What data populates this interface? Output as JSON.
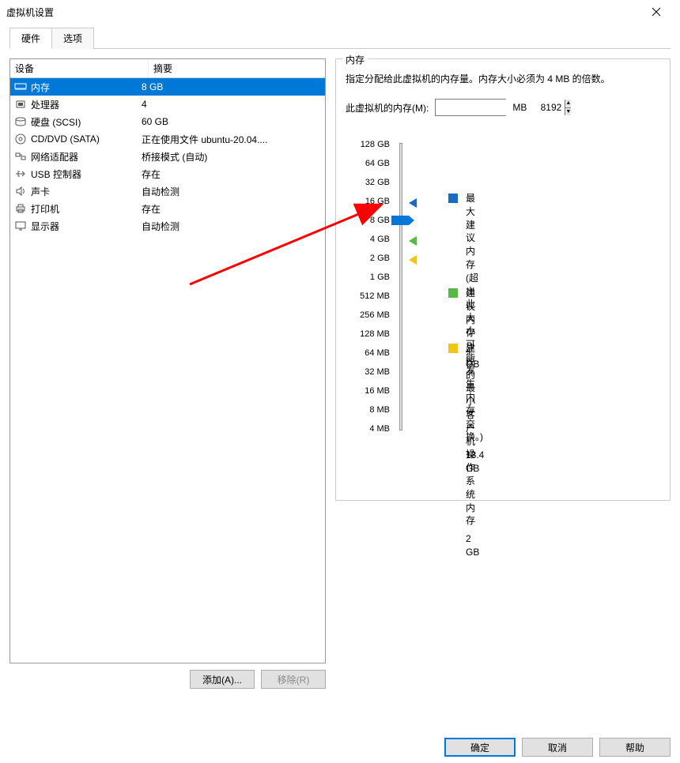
{
  "window": {
    "title": "虚拟机设置"
  },
  "tabs": {
    "hardware": "硬件",
    "options": "选项"
  },
  "table": {
    "col_device": "设备",
    "col_summary": "摘要",
    "rows": [
      {
        "name": "内存",
        "summary": "8 GB",
        "icon": "memory"
      },
      {
        "name": "处理器",
        "summary": "4",
        "icon": "cpu"
      },
      {
        "name": "硬盘 (SCSI)",
        "summary": "60 GB",
        "icon": "disk"
      },
      {
        "name": "CD/DVD (SATA)",
        "summary": "正在使用文件 ubuntu-20.04....",
        "icon": "cd"
      },
      {
        "name": "网络适配器",
        "summary": "桥接模式 (自动)",
        "icon": "net"
      },
      {
        "name": "USB 控制器",
        "summary": "存在",
        "icon": "usb"
      },
      {
        "name": "声卡",
        "summary": "自动检测",
        "icon": "audio"
      },
      {
        "name": "打印机",
        "summary": "存在",
        "icon": "printer"
      },
      {
        "name": "显示器",
        "summary": "自动检测",
        "icon": "display"
      }
    ]
  },
  "buttons": {
    "add": "添加(A)...",
    "remove": "移除(R)",
    "ok": "确定",
    "cancel": "取消",
    "help": "帮助"
  },
  "memory": {
    "panel_title": "内存",
    "description": "指定分配给此虚拟机的内存量。内存大小必须为 4 MB 的倍数。",
    "field_label": "此虚拟机的内存(M):",
    "value": "8192",
    "unit": "MB",
    "scale": [
      "128 GB",
      "64 GB",
      "32 GB",
      "16 GB",
      "8 GB",
      "4 GB",
      "2 GB",
      "1 GB",
      "512 MB",
      "256 MB",
      "128 MB",
      "64 MB",
      "32 MB",
      "16 MB",
      "8 MB",
      "4 MB"
    ],
    "legend_max_title": "最大建议内存",
    "legend_max_note": "(超出此大小可能发生内存交换。)",
    "legend_max_val": "13.4 GB",
    "legend_rec_title": "建议内存",
    "legend_rec_val": "4 GB",
    "legend_min_title": "建议的最小客户机操作系统内存",
    "legend_min_val": "2 GB"
  },
  "colors": {
    "select": "#0078d7",
    "max": "#1a6bbf",
    "rec": "#58b848",
    "min": "#f0c419"
  }
}
